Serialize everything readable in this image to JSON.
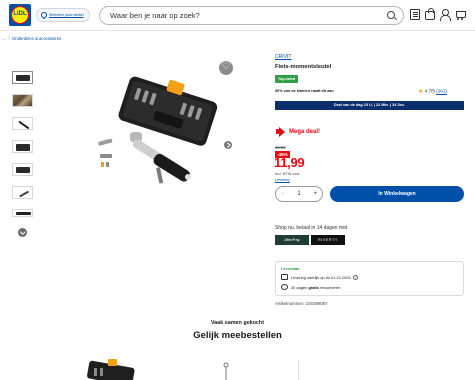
{
  "header": {
    "logo_text": "LIDL",
    "store_label": "Selecteer jouw winkel",
    "search_placeholder": "Waar ben je naar op zoek?"
  },
  "breadcrumb": [
    "...",
    "Onderdelen & accessoires"
  ],
  "product": {
    "brand": "CRIVIT",
    "title": "Fiets-momentsleutel",
    "top_label": "Top-rated",
    "recommend_text": "96% van de klanten raadt dit aan",
    "rating": "4.7/5",
    "rating_count": "(201)",
    "deal_bar": "Deal van de dag 23 U. | 22 Min. | 34 Sec.",
    "mega_deal": "Mega deal!",
    "old_price": "19,99",
    "discount": "-45%",
    "price": "11,99",
    "vat": "Incl. BTW excl.",
    "delivery_link": "Levering",
    "quantity": "1",
    "qty_minus": "−",
    "qty_plus": "+",
    "cart_button": "In Winkelwagen",
    "pay_title": "Shop nu, betaal in 14 dagen met",
    "pay_options": [
      "AfterPay",
      "RIVERTY"
    ],
    "shipping": {
      "title": "Leverbaar",
      "delivery": "Levering uiterlijk op do 01.10.2026",
      "info": "i",
      "returns_prefix": "30 dagen",
      "returns_bold": "gratis",
      "returns_suffix": "retourneren"
    },
    "article_number": "Artikelnummer: 100398057"
  },
  "bottom": {
    "subheading": "Vaak samen gekocht",
    "heading": "Gelijk meebestellen"
  },
  "colors": {
    "brand_blue": "#0050aa",
    "deal_red": "#e60a14",
    "dark_navy": "#0a2e6e",
    "green": "#2f9e44"
  },
  "icons": [
    "location-pin-icon",
    "search-icon",
    "shopping-list-icon",
    "bag-icon",
    "user-icon",
    "cart-icon",
    "heart-icon",
    "chevron-right-icon",
    "chevron-down-icon",
    "megaphone-icon",
    "star-icon",
    "truck-icon",
    "return-icon",
    "info-icon"
  ]
}
